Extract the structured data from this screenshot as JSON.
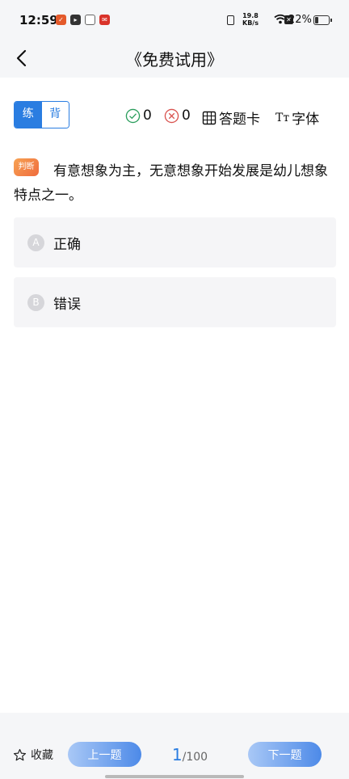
{
  "status_bar": {
    "time": "12:59",
    "notifications": [
      "ad",
      "play",
      "link",
      "news"
    ],
    "net_speed_value": "19.8",
    "net_speed_unit": "KB/s",
    "battery_pct": "22%",
    "battery_level": 0.22
  },
  "header": {
    "title": "《免费试用》",
    "back_icon": "chevron-left-icon"
  },
  "toolbar": {
    "mode_practice": "练",
    "mode_recite": "背",
    "active_mode": "练",
    "correct_count": "0",
    "wrong_count": "0",
    "answer_card": "答题卡",
    "font": "字体",
    "font_icon_text": "Tт"
  },
  "question": {
    "type": "判断",
    "text": "有意想象为主，无意想象开始发展是幼儿想象特点之一。",
    "options": [
      {
        "letter": "A",
        "text": "正确"
      },
      {
        "letter": "B",
        "text": "错误"
      }
    ]
  },
  "footer": {
    "favorite": "收藏",
    "prev": "上一题",
    "next": "下一题",
    "current": "1",
    "total": "/100"
  },
  "colors": {
    "accent": "#2a7de1",
    "badge": "#ef6b3d",
    "correct": "#2a9d5c",
    "wrong": "#d9534f"
  }
}
